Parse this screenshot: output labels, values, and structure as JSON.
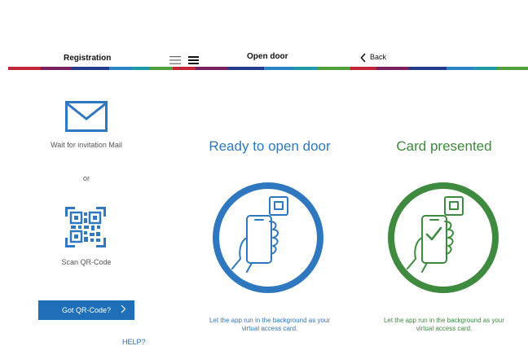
{
  "registration": {
    "title": "Registration",
    "wait_text": "Wait for invitation Mail",
    "or_text": "or",
    "scan_text": "Scan QR-Code",
    "button_label": "Got QR-Code?",
    "help_text": "HELP?"
  },
  "open_door": {
    "title": "Open door",
    "status": "Ready to open door",
    "footnote_line1": "Let the app run in the background as your",
    "footnote_line2": "virtual access card."
  },
  "card_presented": {
    "back_label": "Back",
    "status": "Card presented",
    "footnote_line1": "Let the app run in the background as your",
    "footnote_line2": "virtual access card."
  },
  "colors": {
    "blue": "#2f78c0",
    "green": "#3e8a3e",
    "button": "#1f6fb8"
  },
  "icons": {
    "mail": "mail-icon",
    "qr": "qr-code-icon",
    "menu_light": "menu-icon",
    "menu_bold": "menu-icon",
    "back": "chevron-left-icon",
    "phone_blue": "phone-card-icon",
    "phone_green": "phone-card-check-icon"
  }
}
